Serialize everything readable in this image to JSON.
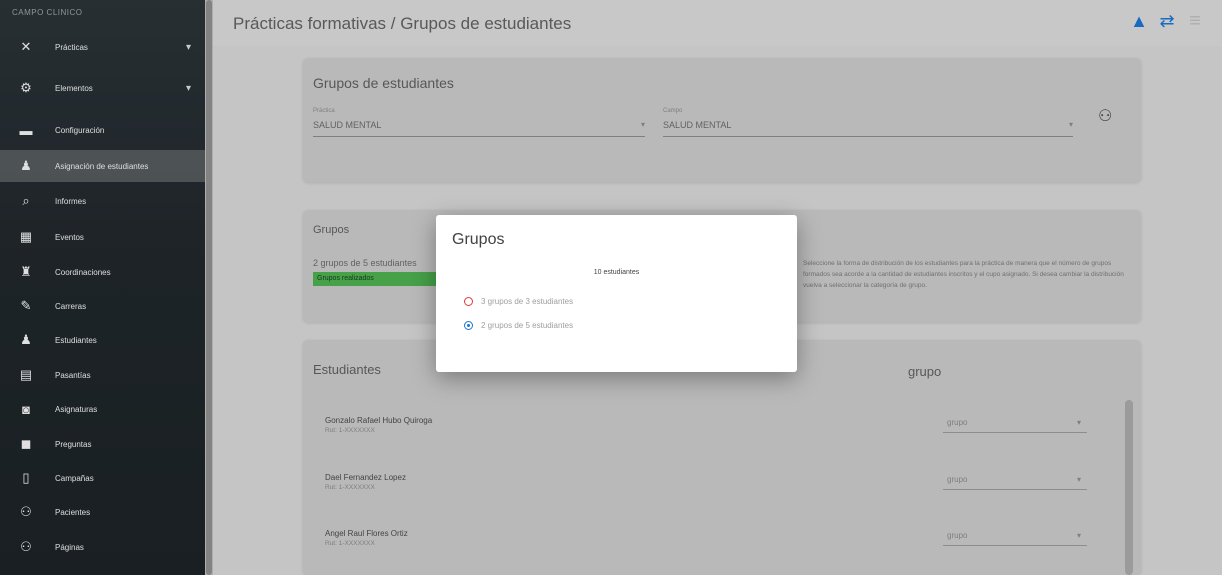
{
  "sidebar": {
    "brand": "CAMPO CLINICO",
    "items": [
      {
        "label": "Prácticas",
        "icon": "close-icon",
        "glyph": "✕",
        "chevron": "▾"
      },
      {
        "label": "Elementos",
        "icon": "gear-icon",
        "glyph": "⚙",
        "chevron": "▾"
      },
      {
        "label": "Configuración",
        "icon": "bus-icon",
        "glyph": "▬",
        "chevron": ""
      },
      {
        "label": "Asignación de estudiantes",
        "icon": "person-icon",
        "glyph": "♟",
        "chevron": ""
      },
      {
        "label": "Informes",
        "icon": "search-icon",
        "glyph": "⌕",
        "chevron": ""
      },
      {
        "label": "Eventos",
        "icon": "calendar-icon",
        "glyph": "▦",
        "chevron": ""
      },
      {
        "label": "Coordinaciones",
        "icon": "user-tie-icon",
        "glyph": "♜",
        "chevron": ""
      },
      {
        "label": "Carreras",
        "icon": "graduation-icon",
        "glyph": "✎",
        "chevron": ""
      },
      {
        "label": "Estudiantes",
        "icon": "student-icon",
        "glyph": "♟",
        "chevron": ""
      },
      {
        "label": "Pasantías",
        "icon": "clipboard-icon",
        "glyph": "▤",
        "chevron": ""
      },
      {
        "label": "Asignaturas",
        "icon": "book-icon",
        "glyph": "◙",
        "chevron": ""
      },
      {
        "label": "Preguntas",
        "icon": "chat-icon",
        "glyph": "◼",
        "chevron": ""
      },
      {
        "label": "Campañas",
        "icon": "document-icon",
        "glyph": "▯",
        "chevron": ""
      },
      {
        "label": "Pacientes",
        "icon": "users-icon",
        "glyph": "⚇",
        "chevron": ""
      },
      {
        "label": "Páginas",
        "icon": "pages-icon",
        "glyph": "⚇",
        "chevron": ""
      }
    ]
  },
  "header": {
    "title": "Prácticas formativas / Grupos de estudiantes"
  },
  "filters": {
    "title": "Grupos de estudiantes",
    "practica_label": "Práctica",
    "practica_value": "SALUD MENTAL",
    "campo_label": "Campo",
    "campo_value": "SALUD MENTAL"
  },
  "groups": {
    "title": "Grupos",
    "summary": "2 grupos de 5 estudiantes",
    "badge": "Grupos realizados",
    "note": "Seleccione la forma de distribución de los estudiantes para la práctica de manera que el número de grupos formados sea acorde a la cantidad de estudiantes inscritos y el cupo asignado. Si desea cambiar la distribución vuelva a seleccionar la categoría de grupo."
  },
  "students": {
    "title": "Estudiantes",
    "group_col": "grupo",
    "select_placeholder": "grupo",
    "rows": [
      {
        "name": "Gonzalo Rafael Hubo Quiroga",
        "id": "Rut: 1-XXXXXXX"
      },
      {
        "name": "Dael Fernandez Lopez",
        "id": "Rut: 1-XXXXXXX"
      },
      {
        "name": "Angel Raul Flores Ortiz",
        "id": "Rut: 1-XXXXXXX"
      }
    ]
  },
  "dialog": {
    "title": "Grupos",
    "subtitle": "10 estudiantes",
    "options": [
      {
        "label": "3 grupos de 3 estudiantes",
        "checked": false
      },
      {
        "label": "2 grupos de 5 estudiantes",
        "checked": true
      }
    ]
  },
  "colors": {
    "accent": "#1976d2",
    "success": "#4caf50",
    "sidebar": "#20272b"
  }
}
